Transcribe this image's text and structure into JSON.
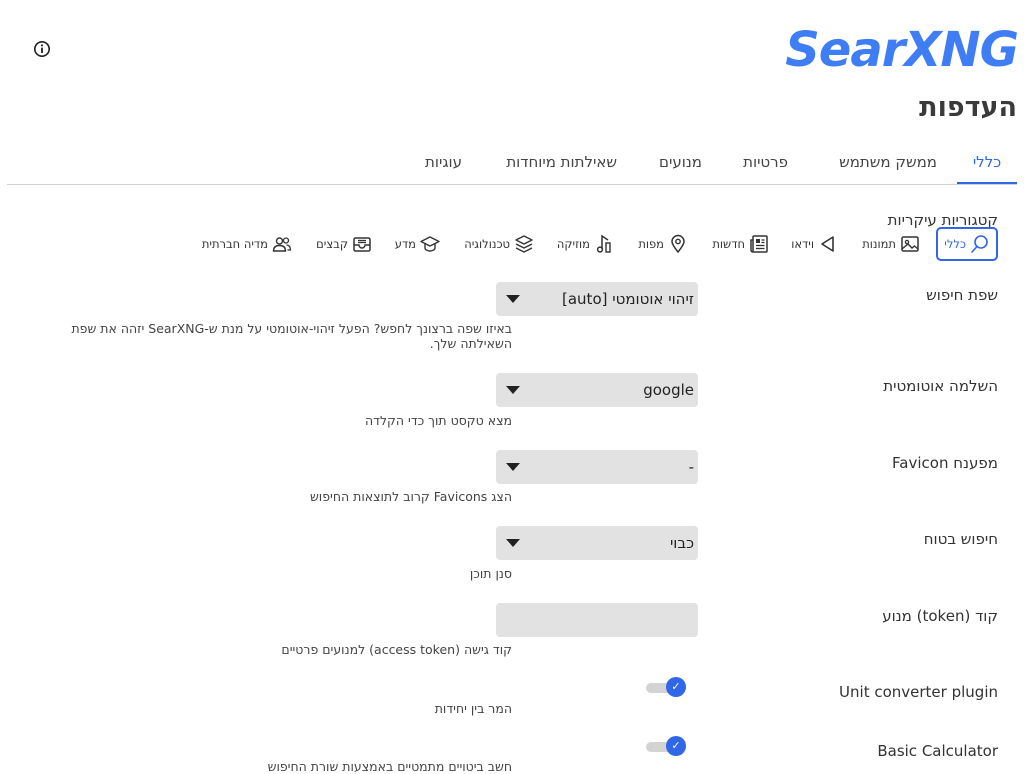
{
  "header": {
    "logo": "SearXNG",
    "title": "העדפות"
  },
  "tabs": [
    {
      "label": "כללי"
    },
    {
      "label": "ממשק משתמש"
    },
    {
      "label": "פרטיות"
    },
    {
      "label": "מנועים"
    },
    {
      "label": "שאילתות מיוחדות"
    },
    {
      "label": "עוגיות"
    }
  ],
  "categories": {
    "label": "קטגוריות עיקריות",
    "items": [
      {
        "label": "כללי",
        "icon": "search-icon"
      },
      {
        "label": "תמונות",
        "icon": "image-icon"
      },
      {
        "label": "וידאו",
        "icon": "play-icon"
      },
      {
        "label": "חדשות",
        "icon": "newspaper-icon"
      },
      {
        "label": "מפות",
        "icon": "map-pin-icon"
      },
      {
        "label": "מוזיקה",
        "icon": "music-icon"
      },
      {
        "label": "טכנולוגיה",
        "icon": "layers-icon"
      },
      {
        "label": "מדע",
        "icon": "graduation-cap-icon"
      },
      {
        "label": "קבצים",
        "icon": "file-tray-icon"
      },
      {
        "label": "מדיה חברתית",
        "icon": "people-icon"
      }
    ]
  },
  "settings": {
    "language": {
      "label": "שפת חיפוש",
      "value": "זיהוי אוטומטי [auto]",
      "help": "באיזו שפה ברצונך לחפש? הפעל זיהוי-אוטומטי על מנת ש-SearXNG יזהה את שפת השאילתה שלך."
    },
    "autocomplete": {
      "label": "השלמה אוטומטית",
      "value": "google",
      "help": "מצא טקסט תוך כדי הקלדה"
    },
    "favicon": {
      "label": "מפענח Favicon",
      "value": "-",
      "help": "הצג Favicons קרוב לתוצאות החיפוש"
    },
    "safesearch": {
      "label": "חיפוש בטוח",
      "value": "כבוי",
      "help": "סנן תוכן"
    },
    "token": {
      "label": "קוד (token) מנוע",
      "value": "",
      "help": "קוד גישה (access token) למנועים פרטיים"
    },
    "unit_converter": {
      "label": "Unit converter plugin",
      "help": "המר בין יחידות",
      "checked": true
    },
    "calculator": {
      "label": "Basic Calculator",
      "help": "חשב ביטויים מתמטיים באמצעות שורת החיפוש",
      "checked": true
    }
  },
  "colors": {
    "accent": "#3066e8",
    "logo": "#3f7df5"
  }
}
